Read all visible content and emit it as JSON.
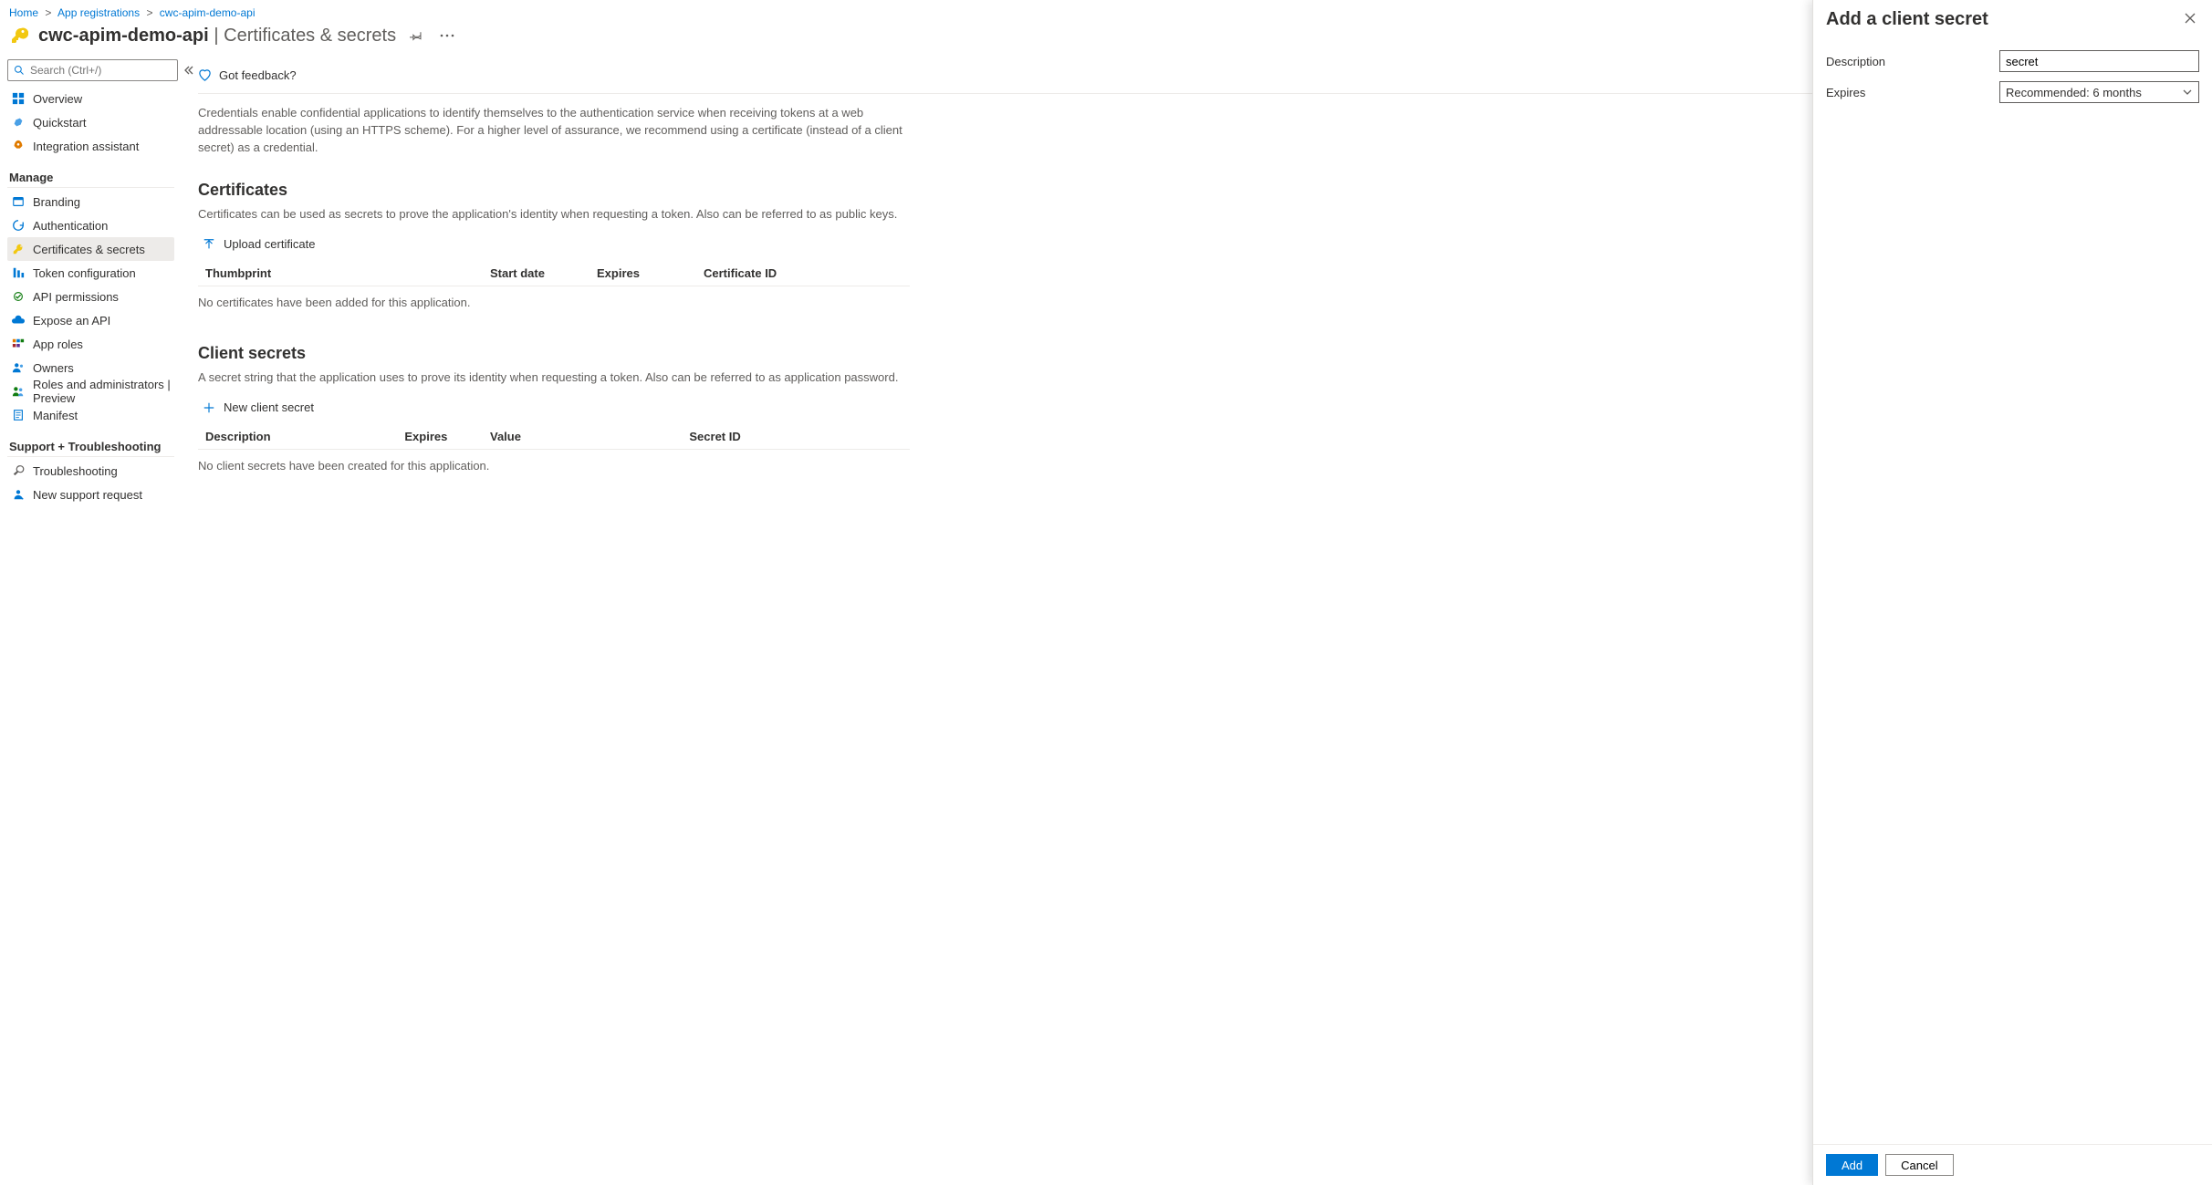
{
  "breadcrumb": {
    "home": "Home",
    "appreg": "App registrations",
    "current": "cwc-apim-demo-api"
  },
  "title": {
    "app": "cwc-apim-demo-api",
    "page": "Certificates & secrets"
  },
  "search": {
    "placeholder": "Search (Ctrl+/)"
  },
  "nav": {
    "top": [
      {
        "icon": "overview",
        "label": "Overview"
      },
      {
        "icon": "quickstart",
        "label": "Quickstart"
      },
      {
        "icon": "rocket",
        "label": "Integration assistant"
      }
    ],
    "manage_title": "Manage",
    "manage": [
      {
        "icon": "branding",
        "label": "Branding"
      },
      {
        "icon": "auth",
        "label": "Authentication"
      },
      {
        "icon": "key",
        "label": "Certificates & secrets",
        "active": true
      },
      {
        "icon": "token",
        "label": "Token configuration"
      },
      {
        "icon": "api-perm",
        "label": "API permissions"
      },
      {
        "icon": "expose",
        "label": "Expose an API"
      },
      {
        "icon": "roles",
        "label": "App roles"
      },
      {
        "icon": "owners",
        "label": "Owners"
      },
      {
        "icon": "admins",
        "label": "Roles and administrators | Preview"
      },
      {
        "icon": "manifest",
        "label": "Manifest"
      }
    ],
    "support_title": "Support + Troubleshooting",
    "support": [
      {
        "icon": "trouble",
        "label": "Troubleshooting"
      },
      {
        "icon": "support",
        "label": "New support request"
      }
    ]
  },
  "main": {
    "feedback": "Got feedback?",
    "intro": "Credentials enable confidential applications to identify themselves to the authentication service when receiving tokens at a web addressable location (using an HTTPS scheme). For a higher level of assurance, we recommend using a certificate (instead of a client secret) as a credential.",
    "certs": {
      "heading": "Certificates",
      "desc": "Certificates can be used as secrets to prove the application's identity when requesting a token. Also can be referred to as public keys.",
      "upload": "Upload certificate",
      "cols": {
        "thumb": "Thumbprint",
        "start": "Start date",
        "exp": "Expires",
        "id": "Certificate ID"
      },
      "empty": "No certificates have been added for this application."
    },
    "secrets": {
      "heading": "Client secrets",
      "desc": "A secret string that the application uses to prove its identity when requesting a token. Also can be referred to as application password.",
      "new": "New client secret",
      "cols": {
        "desc": "Description",
        "exp": "Expires",
        "val": "Value",
        "id": "Secret ID"
      },
      "empty": "No client secrets have been created for this application."
    }
  },
  "panel": {
    "title": "Add a client secret",
    "desc_label": "Description",
    "desc_value": "secret",
    "exp_label": "Expires",
    "exp_value": "Recommended: 6 months",
    "add": "Add",
    "cancel": "Cancel"
  }
}
